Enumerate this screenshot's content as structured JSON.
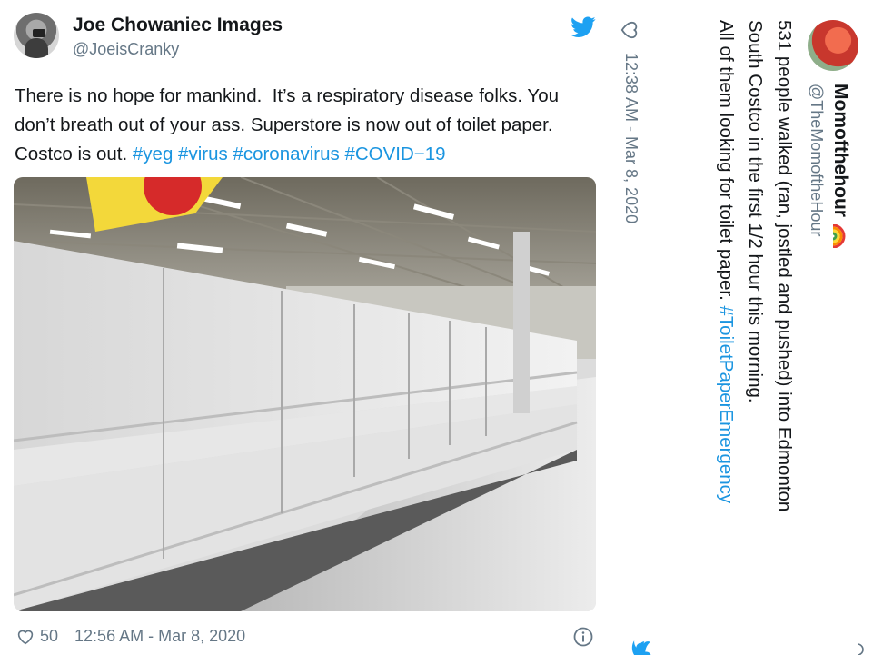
{
  "tweet1": {
    "author_name": "Joe Chowaniec Images",
    "handle": "@JoeisCranky",
    "text_plain": "There is no hope for mankind.  It’s a respiratory disease folks. You don’t breath out of your ass. Superstore is now out of toilet paper.  Costco is out. ",
    "hashtags": "#yeg #virus #coronavirus #COVID−19",
    "likes": "50",
    "timestamp": "12:56 AM - Mar 8, 2020",
    "icons": [
      "twitter-bird-icon",
      "heart-icon",
      "info-icon"
    ]
  },
  "tweet2": {
    "author_name": "Momofthehour",
    "handle": "@TheMomoftheHour",
    "line1": "531 people walked (ran, jostled and pushed) into Edmonton",
    "line2": "South Costco in the first 1/2 hour this morning.",
    "line3_plain": "All of them looking for toilet paper. ",
    "line3_hashtag": "#ToiletPaperEmergency",
    "timestamp": "12:38 AM - Mar 8, 2020",
    "icons": [
      "heart-icon",
      "rainbow-icon",
      "twitter-bird-icon"
    ]
  },
  "colors": {
    "link": "#1b95e0",
    "secondary_text": "#657786",
    "primary_text": "#14171a"
  }
}
